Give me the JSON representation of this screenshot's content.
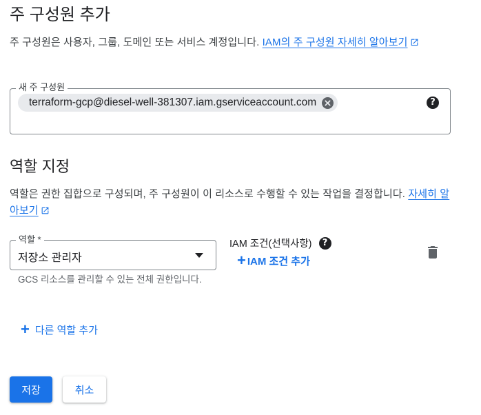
{
  "page": {
    "title": "주 구성원 추가",
    "description": "주 구성원은 사용자, 그룹, 도메인 또는 서비스 계정입니다. ",
    "learn_more_link": "IAM의 주 구성원 자세히 알아보기"
  },
  "principals": {
    "label": "새 주 구성원",
    "chips": [
      "terraform-gcp@diesel-well-381307.iam.gserviceaccount.com"
    ]
  },
  "roles": {
    "section_title": "역할 지정",
    "description": "역할은 권한 집합으로 구성되며, 주 구성원이 이 리소스로 수행할 수 있는 작업을 결정합니다. ",
    "learn_more_link": "자세히 알아보기",
    "role_label": "역할 *",
    "role_value": "저장소 관리자",
    "role_hint": "GCS 리소스를 관리할 수 있는 전체 권한입니다.",
    "condition_label": "IAM 조건(선택사항)",
    "add_condition_label": "IAM 조건 추가",
    "add_role_label": "다른 역할 추가"
  },
  "actions": {
    "save_label": "저장",
    "cancel_label": "취소"
  },
  "colors": {
    "accent": "#1a73e8",
    "chip_bg": "#e8eaed",
    "text": "#202124"
  },
  "icons": [
    "external-link-icon",
    "chip-remove-icon",
    "help-icon",
    "dropdown-arrow-icon",
    "plus-icon",
    "delete-icon"
  ]
}
